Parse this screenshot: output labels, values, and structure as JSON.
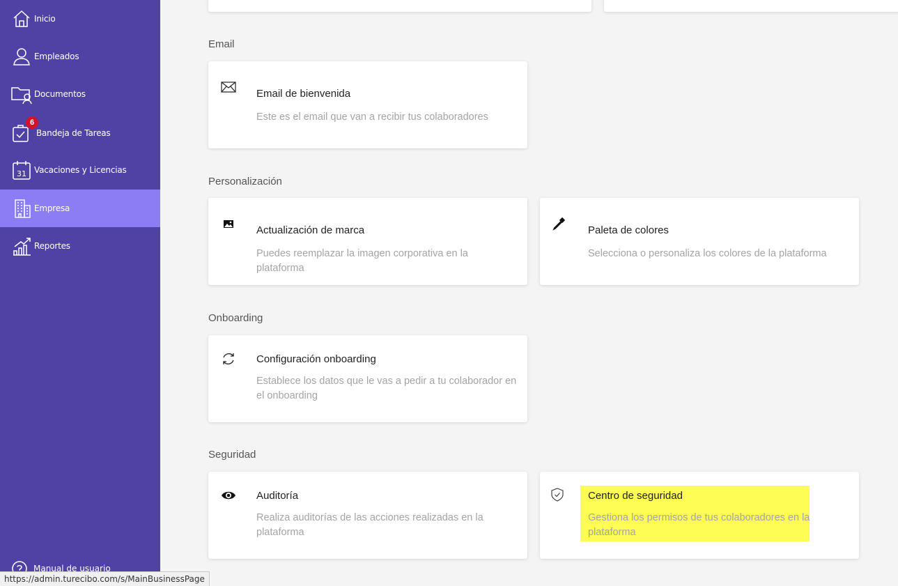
{
  "sidebar": {
    "items": [
      {
        "label": "Inicio",
        "icon": "home-icon"
      },
      {
        "label": "Empleados",
        "icon": "user-icon"
      },
      {
        "label": "Documentos",
        "icon": "folder-user-icon"
      },
      {
        "label": "Bandeja de Tareas",
        "icon": "task-check-icon",
        "badge": "6"
      },
      {
        "label": "Vacaciones y Licencias",
        "icon": "calendar-icon"
      },
      {
        "label": "Empresa",
        "icon": "building-icon",
        "active": true
      },
      {
        "label": "Reportes",
        "icon": "chart-growth-icon"
      }
    ],
    "manual_label": "Manual de usuario"
  },
  "sections": {
    "email": {
      "title": "Email",
      "cards": [
        {
          "title": "Email de bienvenida",
          "desc": "Este es el email que van a recibir tus colaboradores",
          "icon": "envelope-icon"
        }
      ]
    },
    "personalizacion": {
      "title": "Personalización",
      "cards": [
        {
          "title": "Actualización de marca",
          "desc": "Puedes reemplazar la imagen corporativa en la plataforma",
          "icon": "image-icon"
        },
        {
          "title": "Paleta de colores",
          "desc": "Selecciona o personaliza los colores de la plataforma",
          "icon": "eyedropper-icon"
        }
      ]
    },
    "onboarding": {
      "title": "Onboarding",
      "cards": [
        {
          "title": "Configuración onboarding",
          "desc": "Establece los datos que le vas a pedir a tu colaborador en el onboarding",
          "icon": "refresh-icon"
        }
      ]
    },
    "seguridad": {
      "title": "Seguridad",
      "cards": [
        {
          "title": "Auditoría",
          "desc": "Realiza auditorías de las acciones realizadas en la plataforma",
          "icon": "eye-icon"
        },
        {
          "title": "Centro de seguridad",
          "desc": "Gestiona los permisos de tus colaboradores en la plataforma",
          "icon": "shield-check-icon"
        }
      ]
    }
  },
  "status_url": "https://admin.turecibo.com/s/MainBusinessPage",
  "colors": {
    "sidebar_bg": "#5042a5",
    "sidebar_active": "#8c7df5",
    "badge": "#d0142b",
    "highlight": "#fdfd55",
    "page_bg": "#f4f4f4"
  }
}
